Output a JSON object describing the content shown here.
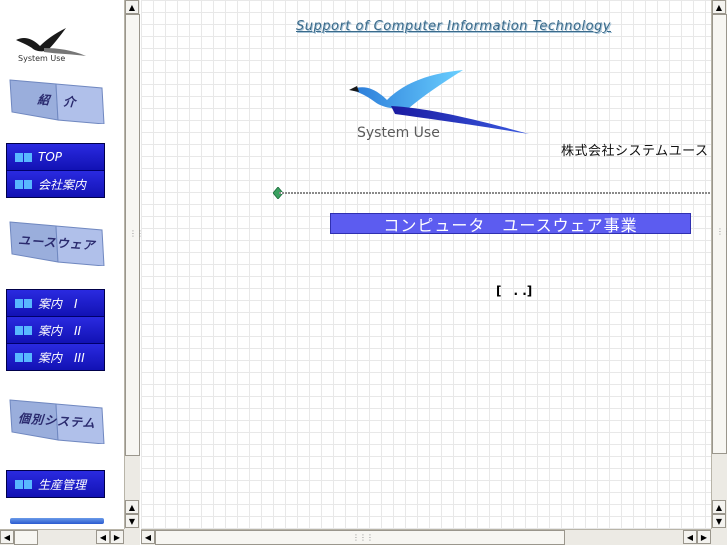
{
  "left_frame": {
    "logo_text": "System Use",
    "sections": [
      {
        "book_label": "紹　介",
        "items": [
          "TOP",
          "会社案内"
        ]
      },
      {
        "book_label": "ユースウェア",
        "items": [
          "案内　I",
          "案内　II",
          "案内　III"
        ]
      },
      {
        "book_label": "個別システム",
        "items": [
          "生産管理"
        ]
      }
    ]
  },
  "right_frame": {
    "tagline": "Support of Computer Information Technology",
    "logo_text": "System Use",
    "company_name": "株式会社システムユース",
    "banner": "コンピュータ　ユースウェア事業",
    "placeholder": "[　. .]"
  },
  "colors": {
    "nav_blue": "#1212b4",
    "banner_blue": "#5c5cf0",
    "icon_cyan": "#58b8ff",
    "tagline": "#3a6a8a"
  },
  "icons": [
    "bird-logo-icon",
    "book-icon",
    "diamond-icon",
    "arrow-up-icon",
    "arrow-down-icon",
    "arrow-left-icon",
    "arrow-right-icon"
  ]
}
